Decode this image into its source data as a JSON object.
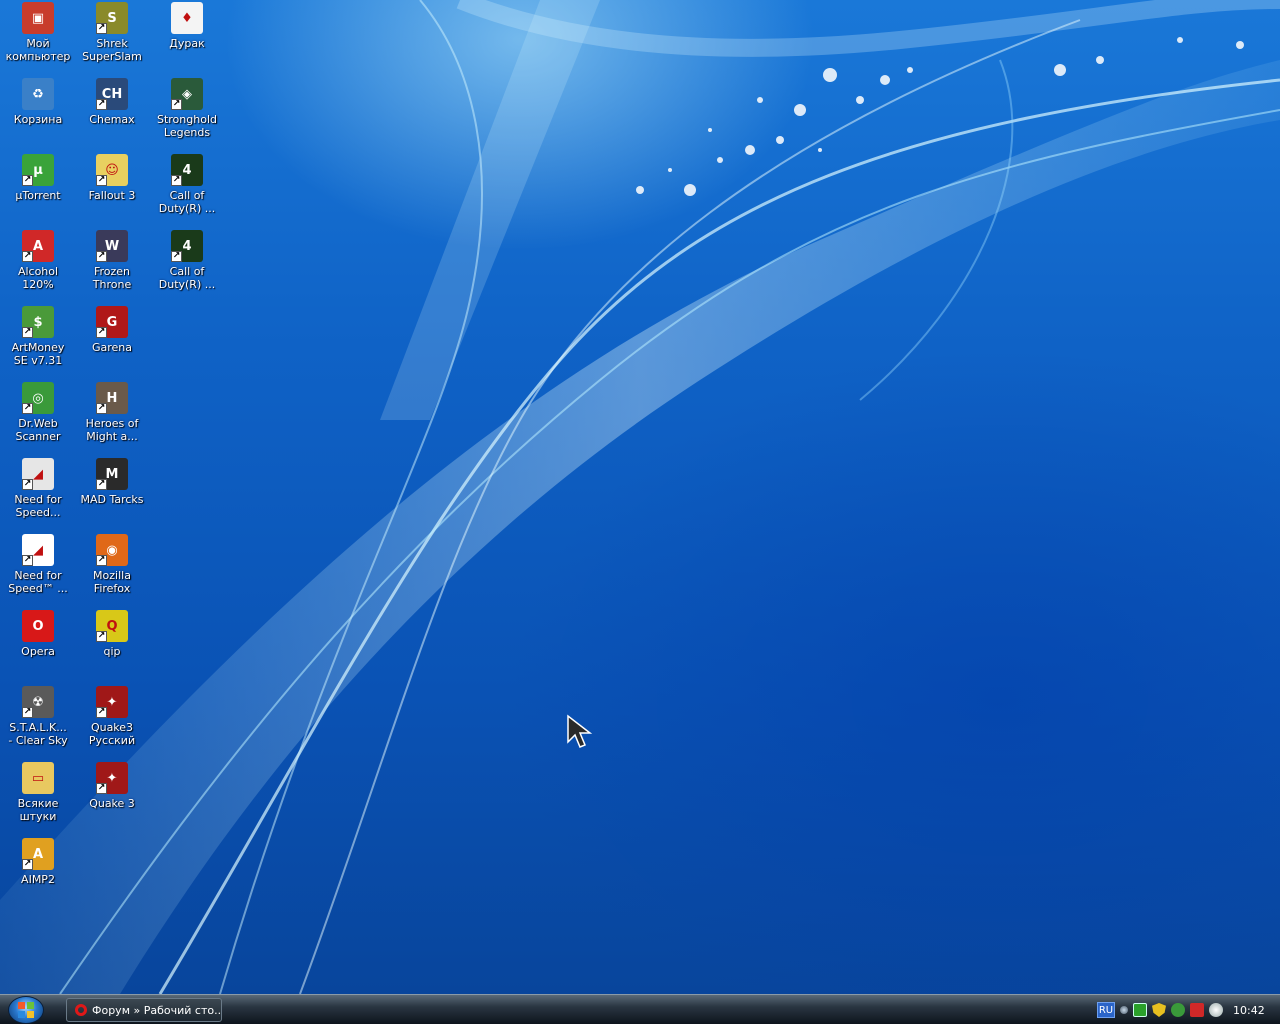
{
  "desktop": {
    "icons": [
      {
        "label": "Мой\nкомпьютер",
        "glyph": "▣",
        "color": "#c83c2c",
        "shortcut": false
      },
      {
        "label": "Корзина",
        "glyph": "♻",
        "color": "#3a80c8",
        "shortcut": false
      },
      {
        "label": "µTorrent",
        "glyph": "µ",
        "color": "#3aa33a",
        "shortcut": true
      },
      {
        "label": "Alcohol\n120%",
        "glyph": "A",
        "color": "#d02828",
        "shortcut": true
      },
      {
        "label": "ArtMoney\nSE v7.31",
        "glyph": "$",
        "color": "#4a9a3a",
        "shortcut": true
      },
      {
        "label": "Dr.Web\nScanner",
        "glyph": "◎",
        "color": "#3a9a3a",
        "shortcut": true
      },
      {
        "label": "Need for\nSpeed...",
        "glyph": "◢",
        "color": "#e6e6e6",
        "shortcut": true
      },
      {
        "label": "Need for\nSpeed™ ...",
        "glyph": "◢",
        "color": "#ffffff",
        "shortcut": true
      },
      {
        "label": "Opera",
        "glyph": "O",
        "color": "#d81818",
        "shortcut": false
      },
      {
        "label": "S.T.A.L.K...\n- Clear Sky",
        "glyph": "☢",
        "color": "#5a5a5a",
        "shortcut": true
      },
      {
        "label": "Всякие\nштуки",
        "glyph": "▭",
        "color": "#e8c860",
        "shortcut": false
      },
      {
        "label": "AIMP2",
        "glyph": "A",
        "color": "#e0a020",
        "shortcut": true
      },
      {
        "label": "Shrek\nSuperSlam",
        "glyph": "S",
        "color": "#8a8a2a",
        "shortcut": true
      },
      {
        "label": "Chemax",
        "glyph": "CH",
        "color": "#2a4a7a",
        "shortcut": true
      },
      {
        "label": "Fallout 3",
        "glyph": "☺",
        "color": "#e8d060",
        "shortcut": true
      },
      {
        "label": "Frozen\nThrone",
        "glyph": "W",
        "color": "#3a3a5a",
        "shortcut": true
      },
      {
        "label": "Garena",
        "glyph": "G",
        "color": "#b01818",
        "shortcut": true
      },
      {
        "label": "Heroes of\nMight a...",
        "glyph": "H",
        "color": "#6a5a4a",
        "shortcut": true
      },
      {
        "label": "MAD Tarcks",
        "glyph": "M",
        "color": "#2a2a2a",
        "shortcut": true
      },
      {
        "label": "Mozilla\nFirefox",
        "glyph": "◉",
        "color": "#e06818",
        "shortcut": true
      },
      {
        "label": "qip",
        "glyph": "Q",
        "color": "#d8c818",
        "shortcut": true
      },
      {
        "label": "Quake3\nРусский",
        "glyph": "✦",
        "color": "#a01818",
        "shortcut": true
      },
      {
        "label": "Quake 3",
        "glyph": "✦",
        "color": "#a01818",
        "shortcut": true
      },
      {
        "label": "Дурак",
        "glyph": "♦",
        "color": "#f4f4f4",
        "shortcut": false
      },
      {
        "label": "Stronghold\nLegends",
        "glyph": "◈",
        "color": "#2a5a3a",
        "shortcut": true
      },
      {
        "label": "Call of\nDuty(R) ...",
        "glyph": "4",
        "color": "#1a3a1a",
        "shortcut": true
      },
      {
        "label": "Call of\nDuty(R) ...",
        "glyph": "4",
        "color": "#1a3a1a",
        "shortcut": true
      }
    ]
  },
  "taskbar": {
    "tasks": [
      {
        "label": "Форум » Рабочий сто..."
      }
    ],
    "tray": {
      "language": "RU",
      "clock": "10:42"
    }
  }
}
